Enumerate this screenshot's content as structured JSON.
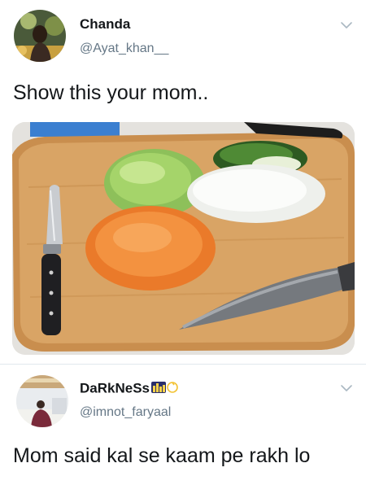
{
  "tweets": [
    {
      "user": {
        "name": "Chanda",
        "handle": "@Ayat_khan__"
      },
      "text": "Show this your mom..",
      "menu_icon": "chevron-down-icon",
      "media": {
        "kind": "photo",
        "alt_icon": "cutting-board-photo"
      }
    },
    {
      "user": {
        "name": "DaRkNeSs",
        "name_decor": "🏙💫",
        "handle": "@imnot_faryaal"
      },
      "text": "Mom said kal se kaam pe rakh lo",
      "menu_icon": "chevron-down-icon"
    }
  ],
  "colors": {
    "text": "#14171a",
    "secondary": "#657786",
    "divider": "#e1e8ed"
  }
}
